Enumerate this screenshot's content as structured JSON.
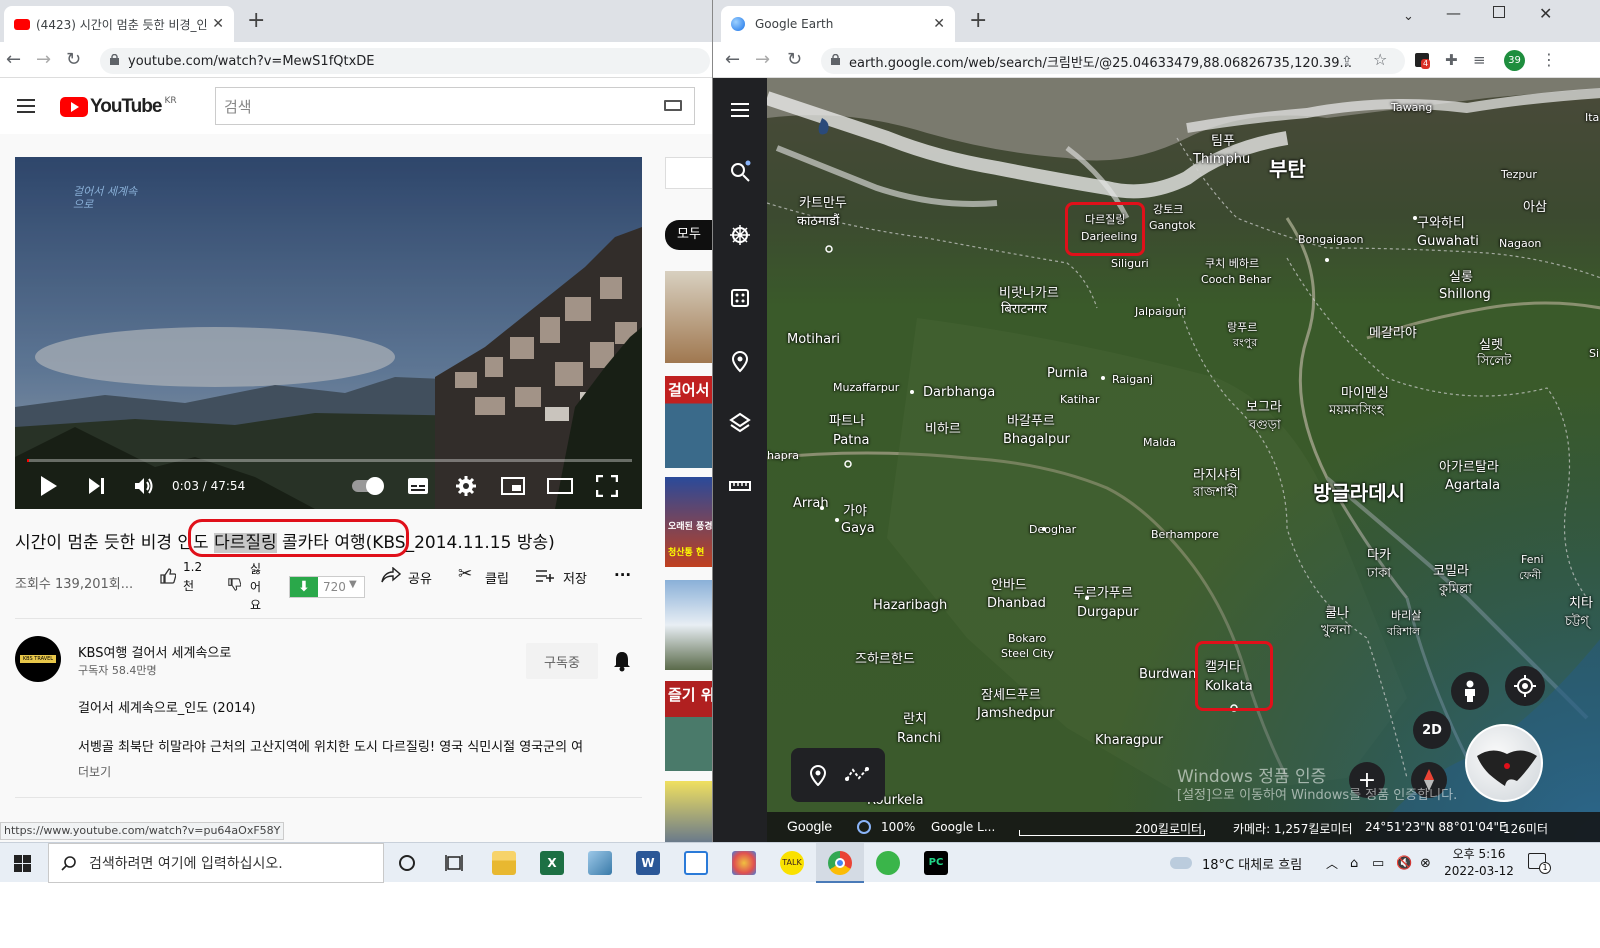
{
  "left_browser": {
    "tab_title": "(4423) 시간이 멈춘 듯한 비경_인",
    "url": "youtube.com/watch?v=MewS1fQtxDE",
    "youtube": {
      "logo_text": "YouTube",
      "region": "KR",
      "search_placeholder": "검색",
      "player": {
        "time": "0:03 / 47:54",
        "overlay_logo": "걸어서 세계속으로"
      },
      "video_title_before": "시간이 멈춘 듯한 비경 ",
      "video_title_boxed_a": "인도 ",
      "video_title_boxed_highlight": "다르질링",
      "video_title_boxed_b": " 콜카타 여행",
      "video_title_after": "(KBS_2014.11.15 방송)",
      "views": "조회수 139,201회...",
      "like_count": "1.2",
      "like_unit": "천",
      "dislike_label": [
        "싫",
        "어",
        "요"
      ],
      "download_count": "720",
      "share_label": "공유",
      "clip_label": "클립",
      "save_label": "저장",
      "more_label": "···",
      "channel_name": "KBS여행 걸어서 세계속으로",
      "avatar_text": "KBS TRAVEL",
      "subscribers": "구독자 58.4만명",
      "subscribed_label": "구독중",
      "description_title": "걸어서 세계속으로_인도 (2014)",
      "description_text": "서벵골 최북단 히말라야 근처의 고산지역에 위치한 도시 다르질링! 영국 식민시절 영국군의 여",
      "more_link": "더보기",
      "chip_all": "모두",
      "side_thumb_texts": [
        "걸어서",
        "오래된 풍경 꿈을",
        "청산통 현",
        "즐기 위"
      ]
    },
    "status_url": "https://www.youtube.com/watch?v=pu64aOxF58Y"
  },
  "right_browser": {
    "tab_title": "Google Earth",
    "url": "earth.google.com/web/search/크림반도/@25.04633479,88.06826735,120.39...",
    "profile_badge": "39",
    "ext_badge": "4",
    "map_labels": {
      "bhutan": "부탄",
      "bangladesh": "방글라데시",
      "kathmandu_ko": "카트만두",
      "kathmandu_ne": "काठमाडौं",
      "thimphu_ko": "팀푸",
      "thimphu": "Thimphu",
      "tawang": "Tawang",
      "tezpur": "Tezpur",
      "assam": "아삼",
      "guwahati_ko": "구와하티",
      "guwahati": "Guwahati",
      "nagaon": "Nagaon",
      "darjeeling_ko": "다르질링",
      "darjeeling": "Darjeeling",
      "gangtok_ko": "강토크",
      "gangtok": "Gangtok",
      "siliguri": "Siliguri",
      "bongaigaon": "Bongaigaon",
      "coochbehar_ko": "쿠치 베하르",
      "coochbehar": "Cooch Behar",
      "shillong_ko": "실롱",
      "shillong": "Shillong",
      "biratnagar_ko": "비랏나가르",
      "biratnagar_ne": "बिराटनगर",
      "jalpaiguri": "Jalpaiguri",
      "rangpur_ko": "랑푸르",
      "rangpur_bn": "রংপুর",
      "meghalaya": "메갈라야",
      "sylhet_ko": "실렛",
      "sylhet_bn": "সিলেট",
      "motihari": "Motihari",
      "purnia": "Purnia",
      "raiganj": "Raiganj",
      "muzaffarpur": "Muzaffarpur",
      "darbhanga": "Darbhanga",
      "katihar": "Katihar",
      "bogra_ko": "보그라",
      "bogra_bn": "বগুড়া",
      "mymensingh_ko": "마이멘싱",
      "mymensingh_bn": "ময়মনসিংহ",
      "patna_ko": "파트나",
      "patna": "Patna",
      "bihar": "비하르",
      "bhagalpur_ko": "바갈푸르",
      "bhagalpur": "Bhagalpur",
      "malda": "Malda",
      "rajshahi_ko": "라지샤히",
      "rajshahi_bn": "রাজশাহী",
      "agartala_ko": "아가르탈라",
      "agartala": "Agartala",
      "apra": "hapra",
      "arrah": "Arrah",
      "gaya_ko": "가야",
      "gaya": "Gaya",
      "deoghar": "Deoghar",
      "berhampore": "Berhampore",
      "dhaka_ko": "다카",
      "dhaka_bn": "ঢাকা",
      "comilla_ko": "코밀라",
      "comilla_bn": "কুমিল্লা",
      "feni": "Feni",
      "feni_bn": "ফেনী",
      "dhanbad_ko": "안바드",
      "dhanbad": "Dhanbad",
      "durgapur_ko": "두르가푸르",
      "durgapur": "Durgapur",
      "hazaribagh": "Hazaribagh",
      "khulna_ko": "쿨나",
      "khulna_bn": "খুলনা",
      "barisal_ko": "바리살",
      "barisal_bn": "বরিশাল",
      "chittagong": "치타",
      "chittagong_bn": "চট্টগ্",
      "bokaro": "Bokaro",
      "bokaro2": "Steel City",
      "jharkhand": "즈하르한드",
      "burdwan": "Burdwan",
      "kolkata_ko": "캘커타",
      "kolkata": "Kolkata",
      "jamshedpur_ko": "잠셰드푸르",
      "jamshedpur": "Jamshedpur",
      "ranchi_ko": "란치",
      "ranchi": "Ranchi",
      "kharagpur": "Kharagpur",
      "rourkela": "Rourkela",
      "ita": "Ita",
      "si": "Si"
    },
    "two_d_label": "2D",
    "watermark_line1": "Windows 정품 인증",
    "watermark_line2": "[설정]으로 이동하여 Windows를 정품 인증합니다.",
    "bottom": {
      "google": "Google",
      "percent": "100%",
      "attribution": "Google L...",
      "scale": "200킬로미터",
      "camera": "카메라: 1,257킬로미터",
      "coords": "24°51'23\"N 88°01'04\"E",
      "altitude": "126미터"
    }
  },
  "taskbar": {
    "search_placeholder": "검색하려면 여기에 입력하십시오.",
    "weather": "18°C  대체로 흐림",
    "time": "오후 5:16",
    "date": "2022-03-12",
    "notif_count": "1"
  },
  "colors": {
    "youtube_red": "#ff0000",
    "annotation_red": "#e0101a",
    "earth_sidebar": "#202124",
    "download_green": "#2aa84a"
  }
}
